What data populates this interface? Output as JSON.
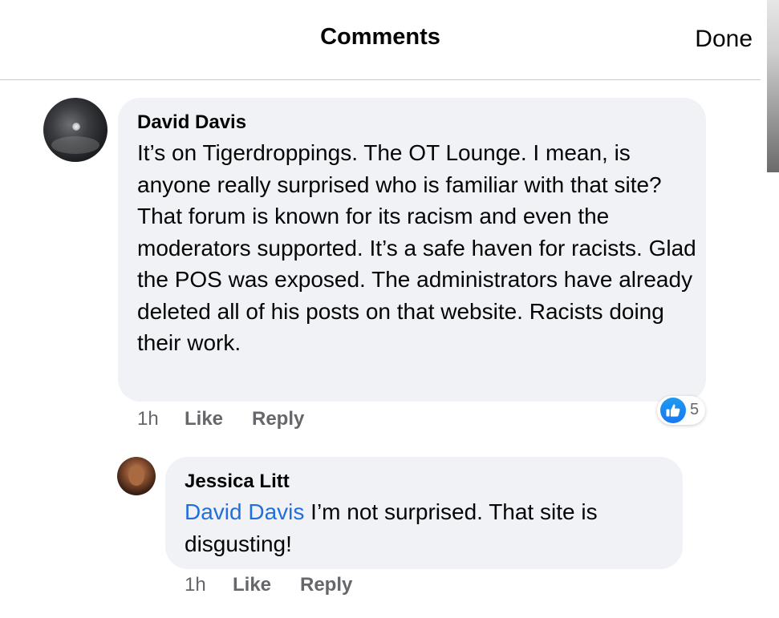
{
  "header": {
    "title": "Comments",
    "done_label": "Done"
  },
  "comments": [
    {
      "author": "David Davis",
      "avatar_icon": "avatar-night-sky-photo",
      "text": "It’s on Tigerdroppings.  The OT Lounge.  I mean, is anyone really surprised who is familiar with that site? That forum is known for its racism and even the moderators supported. It’s a safe haven for racists.  Glad the POS was exposed. The administrators have already deleted all of his posts on that website. Racists doing their work.",
      "time": "1h",
      "like_label": "Like",
      "reply_label": "Reply",
      "reaction": {
        "icon": "thumbs-up-icon",
        "count": "5"
      }
    },
    {
      "author": "Jessica Litt",
      "avatar_icon": "avatar-portrait-photo",
      "mention": "David Davis",
      "text": " I’m not surprised. That site is disgusting!",
      "time": "1h",
      "like_label": "Like",
      "reply_label": "Reply"
    }
  ],
  "colors": {
    "bubble_bg": "#f0f2f5",
    "mention": "#216fdb",
    "meta_text": "#65676b",
    "like_blue": "#1877f2"
  }
}
